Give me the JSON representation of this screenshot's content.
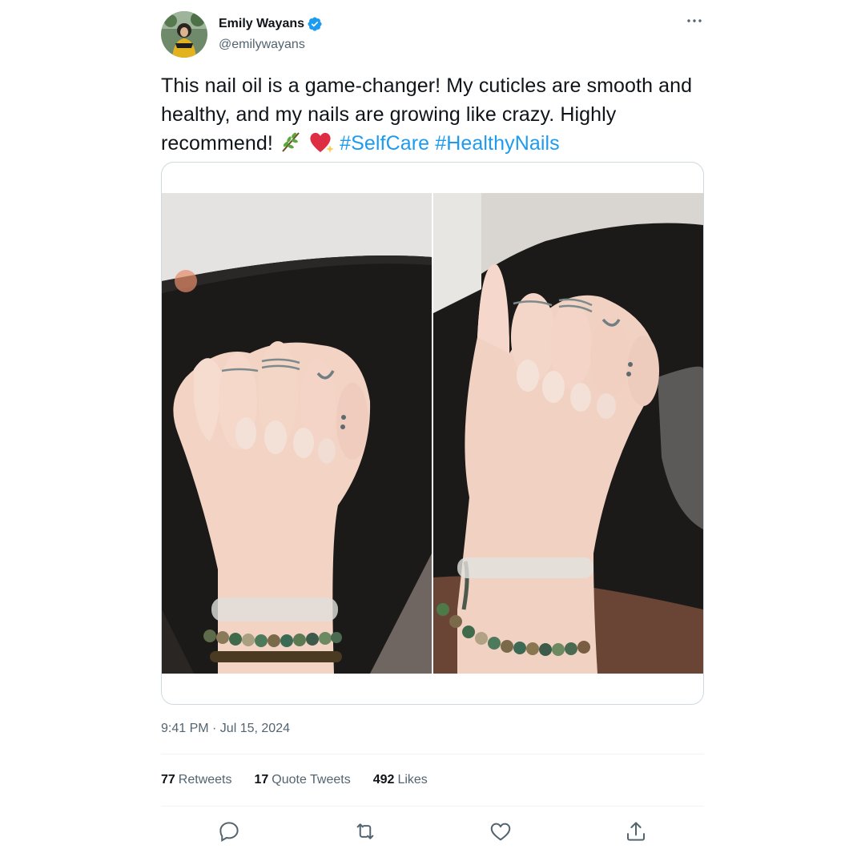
{
  "author": {
    "display_name": "Emily Wayans",
    "handle": "@emilywayans",
    "verified": true,
    "avatar_icon": "avatar-photo"
  },
  "tweet": {
    "text_plain": "This nail oil is a game-changer! My cuticles are smooth and healthy, and my nails are growing like crazy. Highly recommend!",
    "emojis": [
      "herb",
      "heart-with-sparkles"
    ],
    "hashtags": [
      "#SelfCare",
      "#HealthyNails"
    ],
    "timestamp": "9:41 PM · Jul 15, 2024"
  },
  "media": {
    "photos": [
      {
        "subject": "hand-fist-nails-left"
      },
      {
        "subject": "hand-fist-nails-right"
      }
    ]
  },
  "stats": {
    "retweets_count": "77",
    "retweets_label": "Retweets",
    "quotes_count": "17",
    "quotes_label": "Quote Tweets",
    "likes_count": "492",
    "likes_label": "Likes"
  },
  "actions": [
    {
      "icon": "reply-icon"
    },
    {
      "icon": "retweet-icon"
    },
    {
      "icon": "like-icon"
    },
    {
      "icon": "share-icon"
    }
  ],
  "colors": {
    "text": "#0f1419",
    "secondary": "#536471",
    "link": "#1d9bf0",
    "verified": "#1d9bf0",
    "border": "#cfd9de",
    "divider": "#eff3f4"
  }
}
